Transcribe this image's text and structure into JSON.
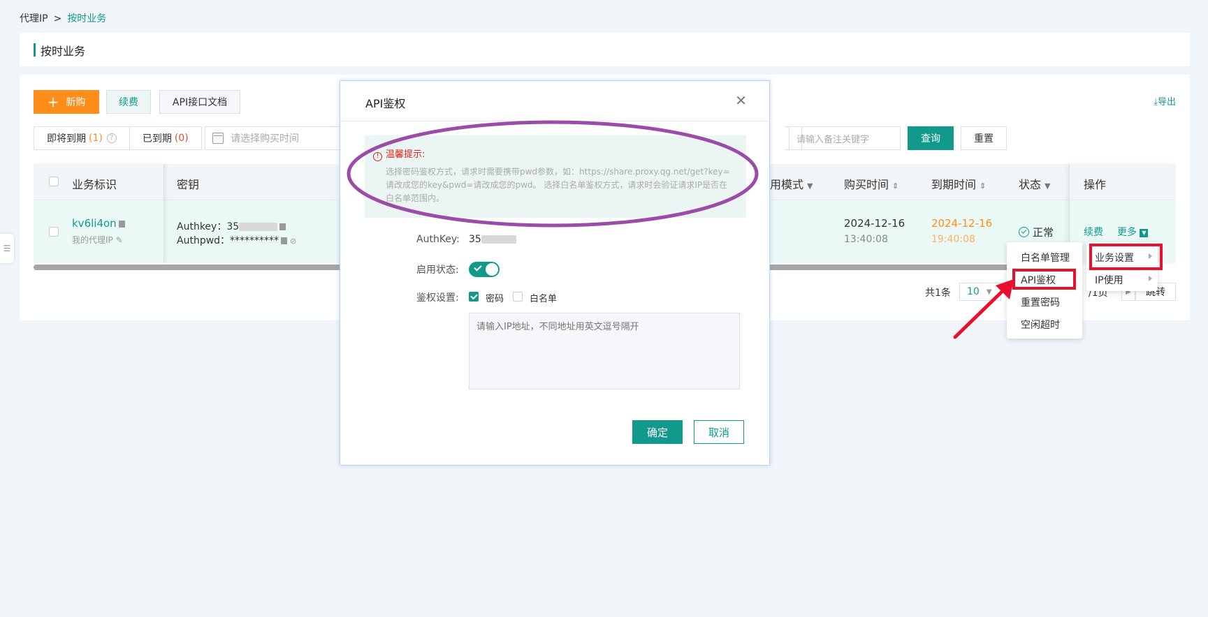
{
  "breadcrumb": {
    "root": "代理IP",
    "separator": ">",
    "current": "按时业务"
  },
  "page_title": "按时业务",
  "toolbar": {
    "new_label": "新购",
    "renew_label": "续费",
    "api_doc_label": "API接口文档",
    "export_label": "导出"
  },
  "filters": {
    "expiring_label": "即将到期",
    "expiring_count": "(1)",
    "expired_label": "已到期",
    "expired_count": "(0)",
    "date_placeholder": "请选择购买时间",
    "remark_placeholder": "请输入备注关键字",
    "query_label": "查询",
    "reset_label": "重置"
  },
  "table": {
    "headers": {
      "id": "业务标识",
      "key": "密钥",
      "mode": "用模式",
      "purchase_time": "购买时间",
      "expire_time": "到期时间",
      "status": "状态",
      "actions": "操作"
    },
    "row": {
      "id": "kv6li4on",
      "remark": "我的代理IP",
      "authkey_label": "Authkey：",
      "authkey_value": "35",
      "authpwd_label": "Authpwd：",
      "authpwd_value": "**********",
      "purchase_date": "2024-12-16",
      "purchase_time": "13:40:08",
      "expire_date": "2024-12-16",
      "expire_time": "19:40:08",
      "status": "正常",
      "renew": "续费",
      "more": "更多"
    }
  },
  "pagination": {
    "total": "共1条",
    "page_size": "10",
    "pages": "/1页",
    "jump": "跳转"
  },
  "menu": {
    "left_items": [
      "白名单管理",
      "API鉴权",
      "重置密码",
      "空闲超时"
    ],
    "right_items": [
      "业务设置",
      "IP使用"
    ]
  },
  "modal": {
    "title": "API鉴权",
    "tip_title": "温馨提示:",
    "tip_body": "选择密码鉴权方式，请求时需要携带pwd参数，如：https://share.proxy.qg.net/get?key=请改成您的key&pwd=请改成您的pwd。 选择白名单鉴权方式，请求时会验证请求IP是否在白名单范围内。",
    "authkey_label": "AuthKey:",
    "authkey_value": "35",
    "enable_label": "启用状态:",
    "enabled": true,
    "auth_label": "鉴权设置:",
    "auth_password": "密码",
    "auth_whitelist": "白名单",
    "ip_placeholder": "请输入IP地址，不同地址用英文逗号隔开",
    "confirm": "确定",
    "cancel": "取消"
  },
  "colors": {
    "primary": "#119a8c",
    "orange": "#ff8d1a",
    "highlight_red": "#e8102a",
    "annotation_purple": "#9b4ba8"
  }
}
